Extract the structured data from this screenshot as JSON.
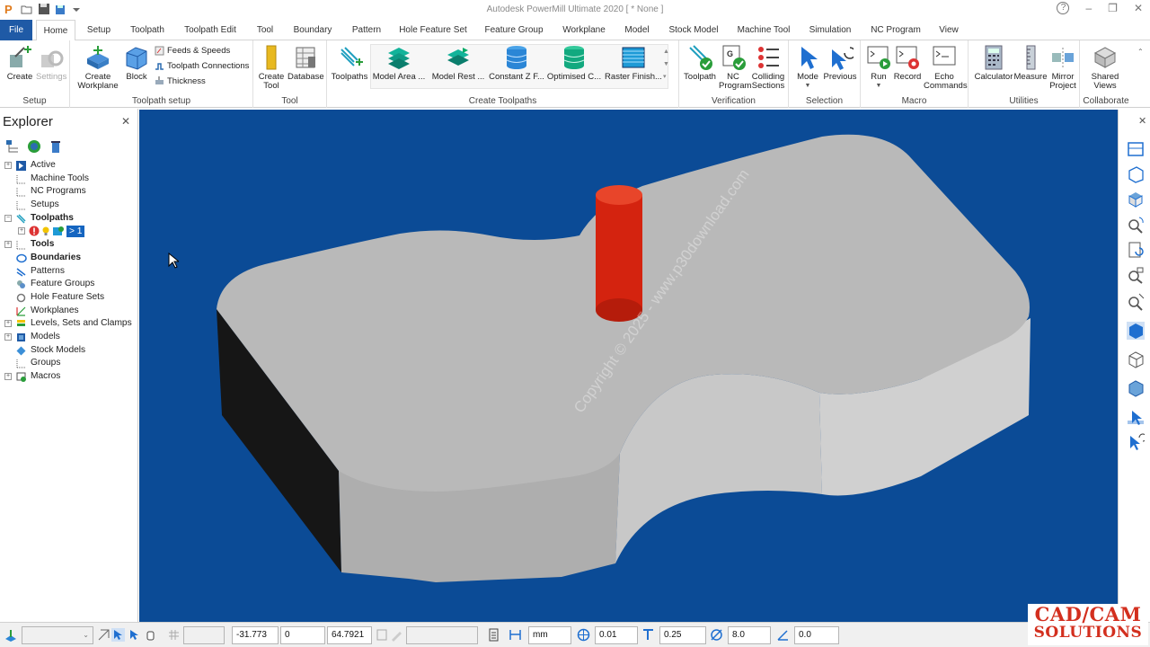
{
  "window": {
    "title": "Autodesk PowerMill Ultimate 2020  [ * None ]",
    "help": "?",
    "minimize": "–",
    "restore": "❐",
    "close": "✕"
  },
  "tabs": [
    "File",
    "Home",
    "Setup",
    "Toolpath",
    "Toolpath Edit",
    "Tool",
    "Boundary",
    "Pattern",
    "Hole Feature Set",
    "Feature Group",
    "Workplane",
    "Model",
    "Stock Model",
    "Machine Tool",
    "Simulation",
    "NC Program",
    "View"
  ],
  "active_tab": "Home",
  "ribbon": {
    "setup": {
      "label": "Setup",
      "create": "Create",
      "settings": "Settings"
    },
    "toolpath_setup": {
      "label": "Toolpath setup",
      "create_workplane_1": "Create",
      "create_workplane_2": "Workplane",
      "block": "Block",
      "feeds": "Feeds & Speeds",
      "connections": "Toolpath Connections",
      "thickness": "Thickness"
    },
    "tool": {
      "label": "Tool",
      "create_tool_1": "Create",
      "create_tool_2": "Tool",
      "database": "Database"
    },
    "create_toolpaths": {
      "label": "Create Toolpaths",
      "toolpaths": "Toolpaths",
      "items": [
        "Model Area ...",
        "Model Rest ...",
        "Constant Z F...",
        "Optimised C...",
        "Raster Finish..."
      ]
    },
    "verification": {
      "label": "Verification",
      "toolpath": "Toolpath",
      "nc_program_1": "NC",
      "nc_program_2": "Program",
      "colliding_1": "Colliding",
      "colliding_2": "Sections"
    },
    "selection": {
      "label": "Selection",
      "mode": "Mode",
      "previous": "Previous"
    },
    "macro": {
      "label": "Macro",
      "run": "Run",
      "record": "Record",
      "echo_1": "Echo",
      "echo_2": "Commands"
    },
    "utilities": {
      "label": "Utilities",
      "calculator": "Calculator",
      "measure": "Measure",
      "mirror_1": "Mirror",
      "mirror_2": "Project"
    },
    "collaborate": {
      "label": "Collaborate",
      "shared_1": "Shared",
      "shared_2": "Views"
    }
  },
  "explorer": {
    "title": "Explorer",
    "items": [
      {
        "label": "Active",
        "bold": false,
        "expand": true
      },
      {
        "label": "Machine Tools",
        "bold": false,
        "expand": false
      },
      {
        "label": "NC Programs",
        "bold": false,
        "expand": false
      },
      {
        "label": "Setups",
        "bold": false,
        "expand": false
      },
      {
        "label": "Toolpaths",
        "bold": true,
        "expand": true
      },
      {
        "label": "> 1",
        "bold": false,
        "expand": true
      },
      {
        "label": "Tools",
        "bold": true,
        "expand": true
      },
      {
        "label": "Boundaries",
        "bold": true,
        "expand": false
      },
      {
        "label": "Patterns",
        "bold": false,
        "expand": false
      },
      {
        "label": "Feature Groups",
        "bold": false,
        "expand": false
      },
      {
        "label": "Hole Feature Sets",
        "bold": false,
        "expand": false
      },
      {
        "label": "Workplanes",
        "bold": false,
        "expand": false
      },
      {
        "label": "Levels, Sets and Clamps",
        "bold": false,
        "expand": true
      },
      {
        "label": "Models",
        "bold": false,
        "expand": true
      },
      {
        "label": "Stock Models",
        "bold": false,
        "expand": false
      },
      {
        "label": "Groups",
        "bold": false,
        "expand": false
      },
      {
        "label": "Macros",
        "bold": false,
        "expand": true
      }
    ]
  },
  "viewport": {
    "watermark": "Copyright © 2025 - www.p30download.com",
    "background": "#0b4b96"
  },
  "status": {
    "x": "-31.773",
    "y": "0",
    "z": "64.7921",
    "units": "mm",
    "tolerance": "0.01",
    "thickness": "0.25",
    "diameter": "8.0",
    "angle": "0.0"
  },
  "brand": {
    "line1": "CAD/CAM",
    "line2": "SOLUTIONS"
  }
}
